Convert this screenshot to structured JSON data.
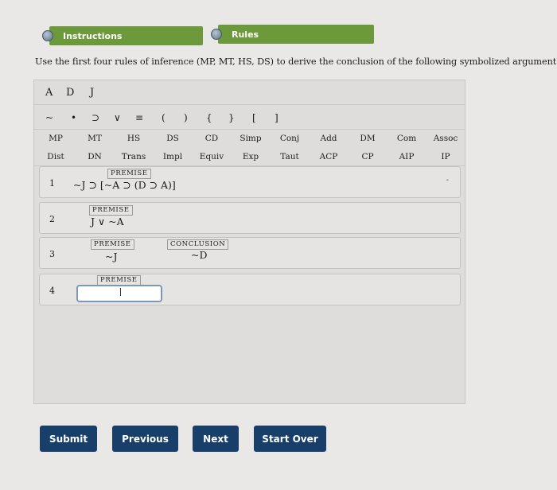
{
  "tabs": {
    "instructions": "Instructions",
    "rules": "Rules"
  },
  "prompt": "Use the first four rules of inference (MP, MT, HS, DS) to derive the conclusion of the following symbolized argument.",
  "variables": [
    "A",
    "D",
    "J"
  ],
  "symbols": [
    "~",
    "•",
    "⊃",
    "∨",
    "≡",
    "(",
    ")",
    "{",
    "}",
    "[",
    "]"
  ],
  "rules_row1": [
    "MP",
    "MT",
    "HS",
    "DS",
    "CD",
    "Simp",
    "Conj",
    "Add",
    "DM",
    "Com",
    "Assoc"
  ],
  "rules_row2": [
    "Dist",
    "DN",
    "Trans",
    "Impl",
    "Equiv",
    "Exp",
    "Taut",
    "ACP",
    "CP",
    "AIP",
    "IP"
  ],
  "lines": [
    {
      "num": "1",
      "tag": "PREMISE",
      "formula": "~J ⊃ [~A ⊃ (D ⊃ A)]",
      "marker": "-"
    },
    {
      "num": "2",
      "tag": "PREMISE",
      "formula": "J ∨ ~A"
    },
    {
      "num": "3",
      "tag": "PREMISE",
      "formula": "~J",
      "conclusion_tag": "CONCLUSION",
      "conclusion": "~D"
    },
    {
      "num": "4",
      "tag": "PREMISE",
      "input_value": ""
    }
  ],
  "buttons": {
    "submit": "Submit",
    "previous": "Previous",
    "next": "Next",
    "start_over": "Start Over"
  },
  "colors": {
    "tab_green": "#6c9a3a",
    "button_navy": "#173f6a",
    "input_border": "#7d97b7"
  }
}
